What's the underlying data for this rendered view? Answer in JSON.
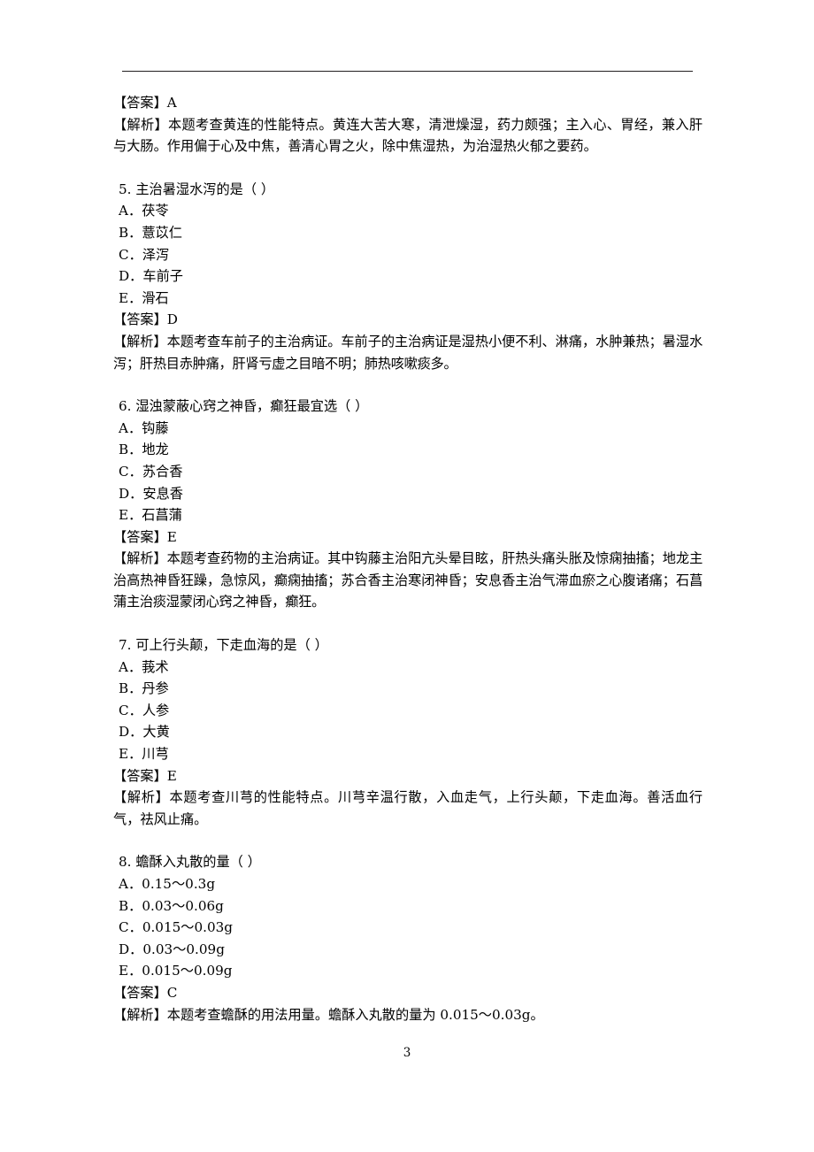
{
  "document": {
    "page_number": "3",
    "header_rule": true
  },
  "top_block": {
    "answer_label": "【答案】",
    "answer_value": "A",
    "explain_label": "【解析】",
    "explain_text": "本题考查黄连的性能特点。黄连大苦大寒，清泄燥湿，药力颇强；主入心、胃经，兼入肝与大肠。作用偏于心及中焦，善清心胃之火，除中焦湿热，为治湿热火郁之要药。"
  },
  "questions": [
    {
      "number": "5.",
      "stem": "主治暑湿水泻的是（      ）",
      "options": [
        {
          "key": "A．",
          "text": "茯苓"
        },
        {
          "key": "B．",
          "text": "薏苡仁"
        },
        {
          "key": "C．",
          "text": "泽泻"
        },
        {
          "key": "D．",
          "text": "车前子"
        },
        {
          "key": "E．",
          "text": "滑石"
        }
      ],
      "answer_label": "【答案】",
      "answer_value": "D",
      "explain_label": "【解析】",
      "explain_text": "本题考查车前子的主治病证。车前子的主治病证是湿热小便不利、淋痛，水肿兼热；暑湿水泻；肝热目赤肿痛，肝肾亏虚之目暗不明；肺热咳嗽痰多。"
    },
    {
      "number": "6.",
      "stem": "湿浊蒙蔽心窍之神昏，癫狂最宜选（      ）",
      "options": [
        {
          "key": "A．",
          "text": "钩藤"
        },
        {
          "key": "B．",
          "text": "地龙"
        },
        {
          "key": "C．",
          "text": "苏合香"
        },
        {
          "key": "D．",
          "text": "安息香"
        },
        {
          "key": "E．",
          "text": "石菖蒲"
        }
      ],
      "answer_label": "【答案】",
      "answer_value": "E",
      "explain_label": "【解析】",
      "explain_text": "本题考查药物的主治病证。其中钩藤主治阳亢头晕目眩，肝热头痛头胀及惊痫抽搐；地龙主治高热神昏狂躁，急惊风，癫痫抽搐；苏合香主治寒闭神昏；安息香主治气滞血瘀之心腹诸痛；石菖蒲主治痰湿蒙闭心窍之神昏，癫狂。"
    },
    {
      "number": "7.",
      "stem": "可上行头颠，下走血海的是（      ）",
      "options": [
        {
          "key": "A．",
          "text": "莪术"
        },
        {
          "key": "B．",
          "text": "丹参"
        },
        {
          "key": "C．",
          "text": "人参"
        },
        {
          "key": "D．",
          "text": "大黄"
        },
        {
          "key": "E．",
          "text": "川芎"
        }
      ],
      "answer_label": "【答案】",
      "answer_value": "E",
      "explain_label": "【解析】",
      "explain_text": "本题考查川芎的性能特点。川芎辛温行散，入血走气，上行头颠，下走血海。善活血行气，祛风止痛。"
    },
    {
      "number": "8.",
      "stem": "蟾酥入丸散的量（      ）",
      "options": [
        {
          "key": "A．",
          "text": "0.15～0.3g"
        },
        {
          "key": "B．",
          "text": "0.03～0.06g"
        },
        {
          "key": "C．",
          "text": "0.015～0.03g"
        },
        {
          "key": "D．",
          "text": "0.03～0.09g"
        },
        {
          "key": "E．",
          "text": "0.015～0.09g"
        }
      ],
      "answer_label": "【答案】",
      "answer_value": "C",
      "explain_label": "【解析】",
      "explain_text": "本题考查蟾酥的用法用量。蟾酥入丸散的量为 0.015～0.03g。"
    }
  ]
}
